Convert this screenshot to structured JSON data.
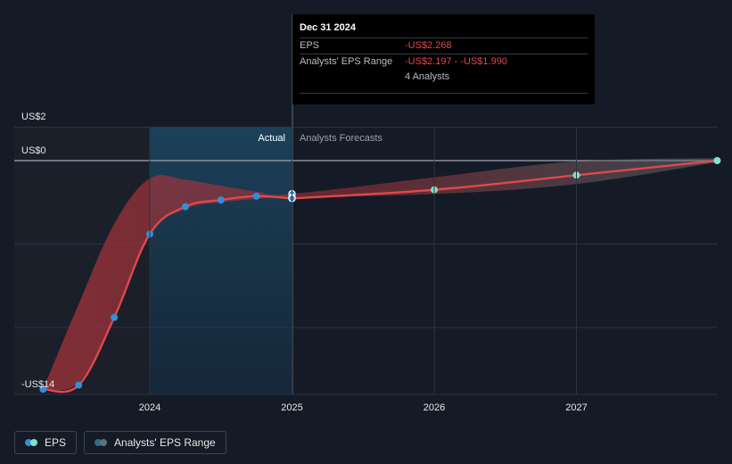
{
  "chart_data": {
    "type": "line",
    "y_axis_labels": [
      "US$2",
      "US$0",
      "-US$14"
    ],
    "x_ticks": [
      "2024",
      "2025",
      "2026",
      "2027"
    ],
    "region_labels": {
      "actual": "Actual",
      "forecast": "Analysts Forecasts"
    },
    "series": [
      {
        "name": "EPS",
        "points": [
          {
            "x": 2023.25,
            "y": -13.7
          },
          {
            "x": 2023.5,
            "y": -13.45
          },
          {
            "x": 2023.75,
            "y": -9.4
          },
          {
            "x": 2024.0,
            "y": -4.4
          },
          {
            "x": 2024.25,
            "y": -2.76
          },
          {
            "x": 2024.5,
            "y": -2.36
          },
          {
            "x": 2024.75,
            "y": -2.13
          },
          {
            "x": 2025.0,
            "y": -2.268
          }
        ]
      },
      {
        "name": "EPS forecast",
        "points": [
          {
            "x": 2025.0,
            "y": -2.268
          },
          {
            "x": 2026.0,
            "y": -1.75
          },
          {
            "x": 2027.0,
            "y": -0.87
          },
          {
            "x": 2027.99,
            "y": 0.0
          }
        ]
      }
    ],
    "range_band": {
      "name": "Analysts' EPS Range",
      "upper": [
        {
          "x": 2023.25,
          "y": -13.7
        },
        {
          "x": 2023.5,
          "y": -8.6
        },
        {
          "x": 2023.75,
          "y": -3.8
        },
        {
          "x": 2024.0,
          "y": -1.07
        },
        {
          "x": 2024.25,
          "y": -1.15
        },
        {
          "x": 2024.5,
          "y": -1.5
        },
        {
          "x": 2024.75,
          "y": -1.85
        },
        {
          "x": 2025.0,
          "y": -1.99
        },
        {
          "x": 2026.0,
          "y": -1.0
        },
        {
          "x": 2027.0,
          "y": -0.05
        },
        {
          "x": 2027.99,
          "y": 0.15
        }
      ],
      "lower": [
        {
          "x": 2023.25,
          "y": -13.7
        },
        {
          "x": 2023.5,
          "y": -13.3
        },
        {
          "x": 2023.75,
          "y": -9.4
        },
        {
          "x": 2024.0,
          "y": -4.4
        },
        {
          "x": 2024.25,
          "y": -2.9
        },
        {
          "x": 2024.5,
          "y": -2.5
        },
        {
          "x": 2024.75,
          "y": -2.3
        },
        {
          "x": 2025.0,
          "y": -2.2
        },
        {
          "x": 2026.0,
          "y": -2.0
        },
        {
          "x": 2027.0,
          "y": -1.4
        },
        {
          "x": 2027.99,
          "y": -0.1
        }
      ]
    },
    "highlight_x": 2025.0,
    "colors": {
      "eps_line": "#e0484b",
      "eps_dot": "#2f8fdc",
      "forecast_dot": "#7fe3c5",
      "band": "#9c2f35",
      "actual_shade": "#1d4a66"
    },
    "xlim": [
      2023.25,
      2027.99
    ],
    "grid": true
  },
  "tooltip": {
    "date": "Dec 31 2024",
    "eps_label": "EPS",
    "eps_value": "-US$2.268",
    "range_label": "Analysts' EPS Range",
    "range_value": "-US$2.197 - -US$1.990",
    "analysts": "4 Analysts"
  },
  "legend": {
    "eps": "EPS",
    "range": "Analysts' EPS Range"
  }
}
